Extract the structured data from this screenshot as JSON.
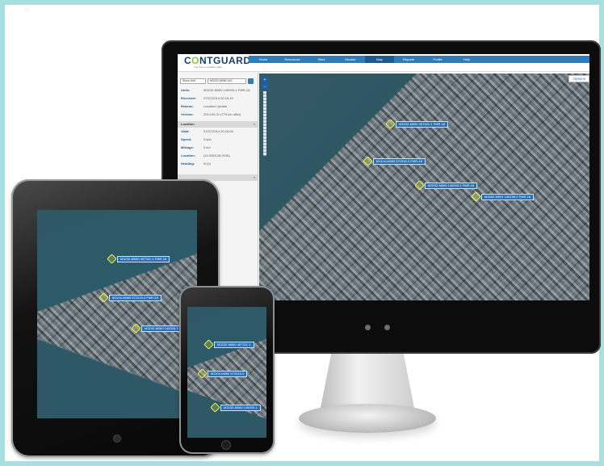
{
  "logo": {
    "text_a": "C",
    "text_o": "O",
    "text_b": "NTGUARD",
    "tagline": "Your link to container data"
  },
  "nav": {
    "items": [
      {
        "label": "Home"
      },
      {
        "label": "Resources"
      },
      {
        "label": "Sites"
      },
      {
        "label": "Monitor"
      },
      {
        "label": "Map",
        "active": true
      },
      {
        "label": "Reports"
      },
      {
        "label": "Profile"
      },
      {
        "label": "Help"
      }
    ]
  },
  "sidebar": {
    "show_select": "Show Unit",
    "unit_select": "M3232-M060 140",
    "details": [
      {
        "k": "Units:",
        "v": "M3232-M060 140003-1 FMR-18"
      },
      {
        "k": "Received:",
        "v": "07/07/2014 20:16:15"
      },
      {
        "k": "Reason:",
        "v": "Location Update"
      },
      {
        "k": "Version:",
        "v": "2014.05.21 (779 km uBlo)"
      }
    ],
    "location_title": "Location",
    "location": [
      {
        "k": "Valid:",
        "v": "07/07/2014 20:16:06"
      },
      {
        "k": "Speed:",
        "v": "0 kph"
      },
      {
        "k": "Mileage:",
        "v": "0 km"
      },
      {
        "k": "Location:",
        "v": "(14.0363,28.9136)"
      },
      {
        "k": "Heading:",
        "v": "N (0)"
      }
    ]
  },
  "map": {
    "options_label": "Options",
    "zoom_in": "+",
    "zoom_out": "−",
    "imac_pins": [
      {
        "label": "M3232-M060 457321-1 FMR-18"
      },
      {
        "label": "M1104-M060 572315-0 FMR-18"
      },
      {
        "label": "M3232-M060 140003-1 FMR-18"
      },
      {
        "label": "M3450-M091 106196-0 FMR-18"
      }
    ],
    "ipad_pins": [
      {
        "label": "M3232-M060 457321-1 FMR-18"
      },
      {
        "label": "M1104-M060 572315-0 FMR-18"
      },
      {
        "label": "M3232-M060 140003-1 FMR-18"
      }
    ],
    "phone_pins": [
      {
        "label": "M3232-M060 457321-1"
      },
      {
        "label": "M1104-M060 572315-0"
      },
      {
        "label": "M3232-M060 140003-1"
      }
    ]
  }
}
